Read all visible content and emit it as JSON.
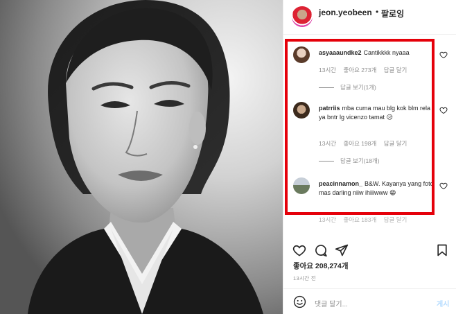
{
  "header": {
    "username": "jeon.yeobeen",
    "separator": "•",
    "follow_label": "팔로잉"
  },
  "comments": [
    {
      "username": "asyaaaundke2",
      "text": "Cantikkkk nyaaa",
      "time": "13시간",
      "likes": "좋아요 273개",
      "reply": "답글 달기",
      "view_replies": "답글 보기(1개)"
    },
    {
      "username": "patrriis",
      "text": "mba cuma mau blg kok blm rela ya bntr lg vicenzo tamat 😥",
      "time": "13시간",
      "likes": "좋아요 198개",
      "reply": "답글 달기",
      "view_replies": "답글 보기(18개)"
    },
    {
      "username": "peacinnamon_",
      "text": "B&W. Kayanya yang foto mas darling niiw ihiiiwww 😁",
      "time": "13시간",
      "likes": "좋아요 183개",
      "reply": "답글 달기"
    }
  ],
  "post": {
    "likes": "좋아요 208,274개",
    "time": "13시간 전"
  },
  "add_comment": {
    "placeholder": "댓글 달기...",
    "post_label": "게시"
  },
  "icons": {
    "like": "heart-icon",
    "comment": "comment-icon",
    "share": "paper-plane-icon",
    "save": "bookmark-icon",
    "emoji": "smiley-icon"
  },
  "colors": {
    "highlight": "#e5000a",
    "secondary_text": "#8e8e8e",
    "post_button_disabled": "#b3dbff"
  }
}
